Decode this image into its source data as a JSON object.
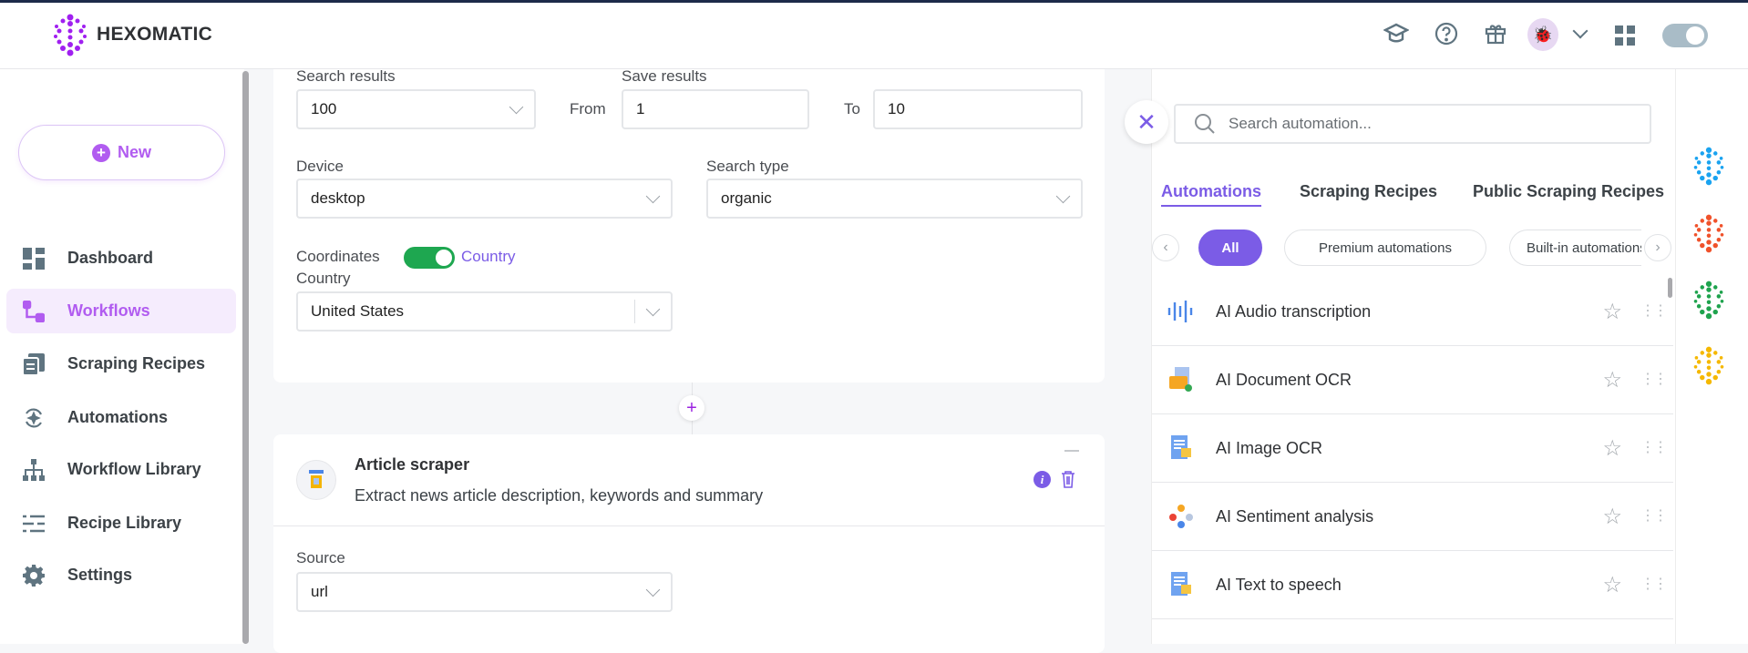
{
  "brand": {
    "name": "HEXOMATIC",
    "accent": "#b15cf0"
  },
  "header": {
    "icons": [
      "graduation-cap-icon",
      "help-icon",
      "gift-icon",
      "avatar",
      "chevron-down-icon",
      "apps-grid-icon",
      "theme-toggle"
    ]
  },
  "sidebar": {
    "new_label": "New",
    "items": [
      {
        "label": "Dashboard",
        "icon": "dashboard-icon"
      },
      {
        "label": "Workflows",
        "icon": "workflow-icon",
        "active": true
      },
      {
        "label": "Scraping Recipes",
        "icon": "recipe-icon"
      },
      {
        "label": "Automations",
        "icon": "automation-icon"
      },
      {
        "label": "Workflow Library",
        "icon": "library-icon"
      },
      {
        "label": "Recipe Library",
        "icon": "list-icon"
      },
      {
        "label": "Settings",
        "icon": "gear-icon"
      }
    ]
  },
  "main": {
    "search_results": {
      "label": "Search results",
      "value": "100"
    },
    "save_results": {
      "label": "Save results",
      "from_label": "From",
      "from_value": "1",
      "to_label": "To",
      "to_value": "10"
    },
    "device": {
      "label": "Device",
      "value": "desktop"
    },
    "search_type": {
      "label": "Search type",
      "value": "organic"
    },
    "toggle": {
      "left_label": "Coordinates",
      "right_label": "Country",
      "on": true
    },
    "country": {
      "label": "Country",
      "value": "United States"
    },
    "article": {
      "title": "Article scraper",
      "description": "Extract news article description, keywords and summary",
      "source_label": "Source",
      "source_value": "url"
    }
  },
  "panel": {
    "search_placeholder": "Search automation...",
    "tabs": [
      "Automations",
      "Scraping Recipes",
      "Public Scraping Recipes"
    ],
    "chips": [
      "All",
      "Premium automations",
      "Built-in automations"
    ],
    "items": [
      "AI Audio transcription",
      "AI Document OCR",
      "AI Image OCR",
      "AI Sentiment analysis",
      "AI Text to speech"
    ]
  },
  "strip_colors": [
    "#1aa3f0",
    "#f0522b",
    "#1fa34e",
    "#f5b800"
  ]
}
